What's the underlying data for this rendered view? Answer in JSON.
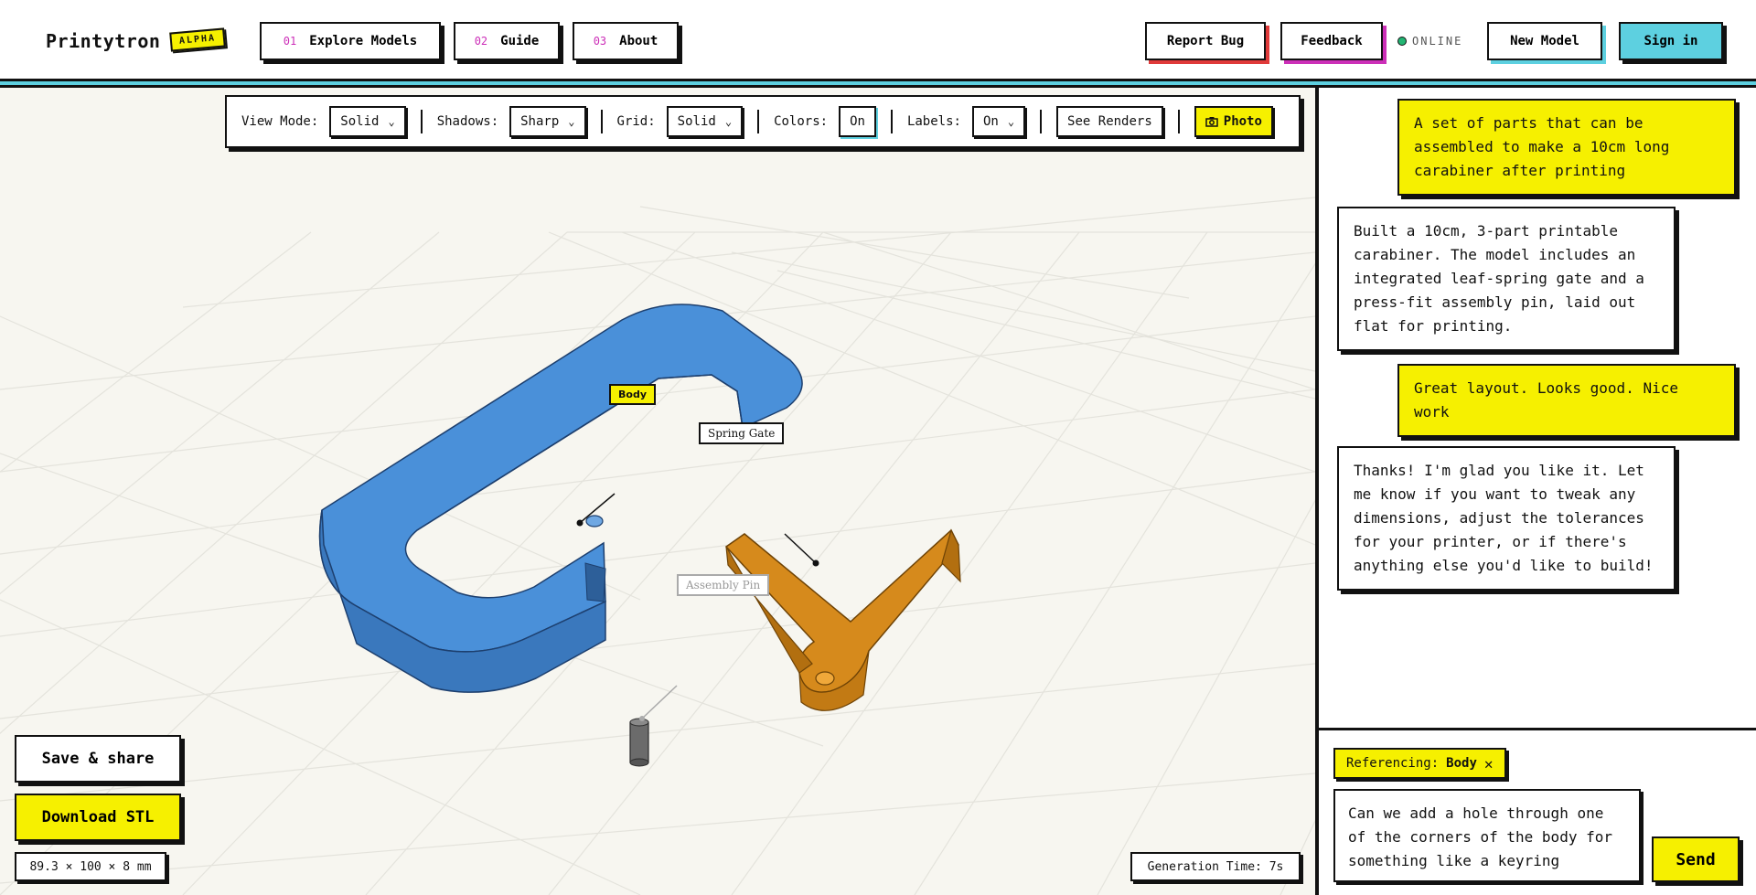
{
  "app": {
    "name": "Printytron",
    "badge": "ALPHA"
  },
  "nav": [
    {
      "num": "01",
      "label": "Explore Models"
    },
    {
      "num": "02",
      "label": "Guide"
    },
    {
      "num": "03",
      "label": "About"
    }
  ],
  "header_actions": {
    "report_bug": "Report Bug",
    "feedback": "Feedback",
    "status": "ONLINE",
    "new_model": "New Model",
    "sign_in": "Sign in"
  },
  "toolbar": {
    "view_mode_label": "View Mode:",
    "view_mode": "Solid",
    "shadows_label": "Shadows:",
    "shadows": "Sharp",
    "grid_label": "Grid:",
    "grid": "Solid",
    "colors_label": "Colors:",
    "colors": "On",
    "labels_label": "Labels:",
    "labels": "On",
    "see_renders": "See Renders",
    "photo": "Photo"
  },
  "model_labels": {
    "body": "Body",
    "spring_gate": "Spring Gate",
    "assembly_pin": "Assembly Pin"
  },
  "viewport": {
    "save_share": "Save & share",
    "download_stl": "Download STL",
    "dimensions": "89.3 × 100 × 8 mm",
    "generation_time": "Generation Time: 7s"
  },
  "colors": {
    "accent_yellow": "#f6f000",
    "accent_cyan": "#5dd0e0",
    "body_blue": "#4a90d9",
    "gate_orange": "#d68a1c",
    "pin_gray": "#6b6b6b"
  },
  "chat": {
    "messages": [
      {
        "role": "user",
        "text": "A set of parts that can be assembled to make a 10cm long carabiner after printing"
      },
      {
        "role": "assistant",
        "text": "Built a 10cm, 3-part printable carabiner. The model includes an integrated leaf-spring gate and a press-fit assembly pin, laid out flat for printing."
      },
      {
        "role": "user",
        "text": "Great layout. Looks good. Nice work"
      },
      {
        "role": "assistant",
        "text": "Thanks! I'm glad you like it. Let me know if you want to tweak any dimensions, adjust the tolerances for your printer, or if there's anything else you'd like to build!"
      }
    ],
    "reference_label": "Referencing:",
    "reference_value": "Body",
    "input_value": "Can we add a hole through one of the corners of the body for something like a keyring",
    "send": "Send"
  }
}
